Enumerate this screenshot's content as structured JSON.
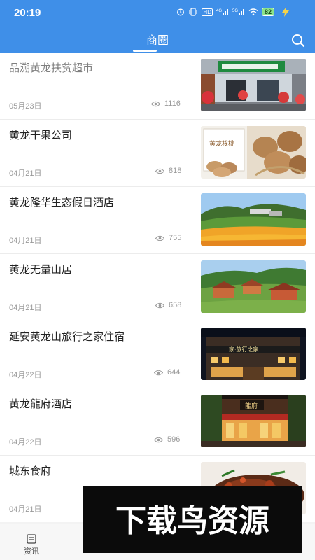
{
  "status_bar": {
    "time": "20:19",
    "icons": [
      "alarm-icon",
      "vibrate-icon",
      "hd-icon",
      "signal-4g-icon",
      "signal-5g-icon",
      "wifi-icon"
    ],
    "battery": "82"
  },
  "header": {
    "title": "商圈",
    "accent_color": "#3f8fe8"
  },
  "items": [
    {
      "title": "品溯黄龙扶贫超市",
      "date": "05月23日",
      "views": "1116"
    },
    {
      "title": "黄龙干果公司",
      "date": "04月21日",
      "views": "818"
    },
    {
      "title": "黄龙隆华生态假日酒店",
      "date": "04月21日",
      "views": "755"
    },
    {
      "title": "黄龙无量山居",
      "date": "04月21日",
      "views": "658"
    },
    {
      "title": "延安黄龙山旅行之家住宿",
      "date": "04月22日",
      "views": "644"
    },
    {
      "title": "黄龙龍府酒店",
      "date": "04月22日",
      "views": "596"
    },
    {
      "title": "城东食府",
      "date": "04月21日",
      "views": ""
    }
  ],
  "thumb_text": {
    "walnut_brand": "黄龙核桃",
    "hotel_sign": "家·旅行之家",
    "longfu_sign": "龍府"
  },
  "bottom_nav": {
    "items": [
      {
        "label": "资讯",
        "icon": "news-icon"
      }
    ]
  },
  "watermark": {
    "text": "下载鸟资源"
  }
}
